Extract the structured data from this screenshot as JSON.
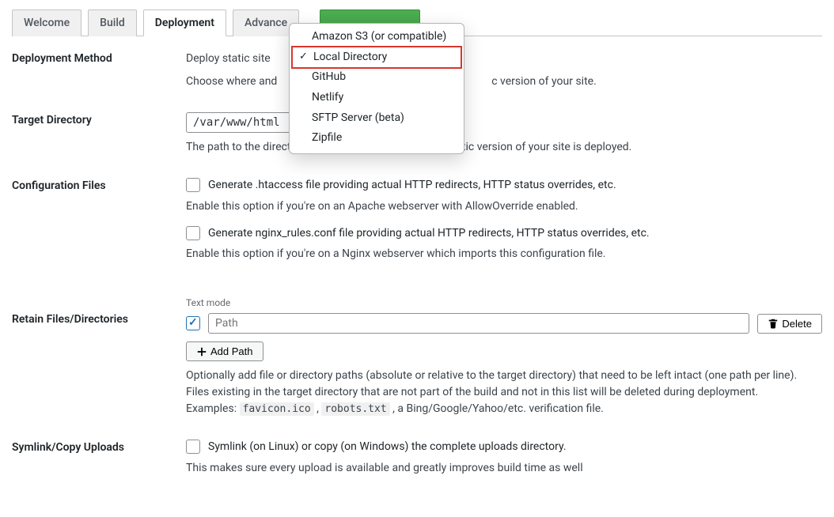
{
  "tabs": [
    {
      "label": "Welcome"
    },
    {
      "label": "Build"
    },
    {
      "label": "Deployment"
    },
    {
      "label": "Advance"
    }
  ],
  "deployment_method": {
    "label": "Deployment Method",
    "description_prefix": "Deploy static site ",
    "help": "Choose where and ",
    "help_suffix": "c version of your site.",
    "dropdown": {
      "items": [
        "Amazon S3 (or compatible)",
        "Local Directory",
        "GitHub",
        "Netlify",
        "SFTP Server (beta)",
        "Zipfile"
      ],
      "selected_index": 1
    }
  },
  "target_directory": {
    "label": "Target Directory",
    "value": "/var/www/html",
    "help": "The path to the directory on the filesystem where the static version of your site is deployed."
  },
  "configuration_files": {
    "label": "Configuration Files",
    "htaccess_label": "Generate .htaccess file providing actual HTTP redirects, HTTP status overrides, etc.",
    "htaccess_help": "Enable this option if you're on an Apache webserver with AllowOverride enabled.",
    "nginx_label": "Generate nginx_rules.conf file providing actual HTTP redirects, HTTP status overrides, etc.",
    "nginx_help": "Enable this option if you're on a Nginx webserver which imports this configuration file."
  },
  "retain": {
    "label": "Retain Files/Directories",
    "mode_label": "Text mode",
    "path_placeholder": "Path",
    "delete_label": "Delete",
    "add_path_label": "Add Path",
    "help1": "Optionally add file or directory paths (absolute or relative to the target directory) that need to be left intact (one path per line).",
    "help2": "Files existing in the target directory that are not part of the build and not in this list will be deleted during deployment.",
    "help3_pre": "Examples: ",
    "help3_code1": "favicon.ico",
    "help3_sep": " , ",
    "help3_code2": "robots.txt",
    "help3_post": " , a Bing/Google/Yahoo/etc. verification file."
  },
  "symlink": {
    "label": "Symlink/Copy Uploads",
    "checkbox_label": "Symlink (on Linux) or copy (on Windows) the complete uploads directory.",
    "help": "This makes sure every upload is available and greatly improves build time as well"
  }
}
